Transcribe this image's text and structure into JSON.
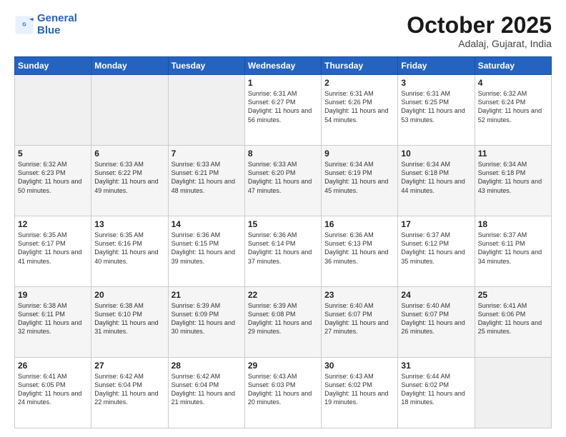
{
  "header": {
    "logo_general": "General",
    "logo_blue": "Blue",
    "month_title": "October 2025",
    "location": "Adalaj, Gujarat, India"
  },
  "weekdays": [
    "Sunday",
    "Monday",
    "Tuesday",
    "Wednesday",
    "Thursday",
    "Friday",
    "Saturday"
  ],
  "weeks": [
    [
      {
        "day": "",
        "sunrise": "",
        "sunset": "",
        "daylight": "",
        "empty": true
      },
      {
        "day": "",
        "sunrise": "",
        "sunset": "",
        "daylight": "",
        "empty": true
      },
      {
        "day": "",
        "sunrise": "",
        "sunset": "",
        "daylight": "",
        "empty": true
      },
      {
        "day": "1",
        "sunrise": "Sunrise: 6:31 AM",
        "sunset": "Sunset: 6:27 PM",
        "daylight": "Daylight: 11 hours and 56 minutes."
      },
      {
        "day": "2",
        "sunrise": "Sunrise: 6:31 AM",
        "sunset": "Sunset: 6:26 PM",
        "daylight": "Daylight: 11 hours and 54 minutes."
      },
      {
        "day": "3",
        "sunrise": "Sunrise: 6:31 AM",
        "sunset": "Sunset: 6:25 PM",
        "daylight": "Daylight: 11 hours and 53 minutes."
      },
      {
        "day": "4",
        "sunrise": "Sunrise: 6:32 AM",
        "sunset": "Sunset: 6:24 PM",
        "daylight": "Daylight: 11 hours and 52 minutes."
      }
    ],
    [
      {
        "day": "5",
        "sunrise": "Sunrise: 6:32 AM",
        "sunset": "Sunset: 6:23 PM",
        "daylight": "Daylight: 11 hours and 50 minutes."
      },
      {
        "day": "6",
        "sunrise": "Sunrise: 6:33 AM",
        "sunset": "Sunset: 6:22 PM",
        "daylight": "Daylight: 11 hours and 49 minutes."
      },
      {
        "day": "7",
        "sunrise": "Sunrise: 6:33 AM",
        "sunset": "Sunset: 6:21 PM",
        "daylight": "Daylight: 11 hours and 48 minutes."
      },
      {
        "day": "8",
        "sunrise": "Sunrise: 6:33 AM",
        "sunset": "Sunset: 6:20 PM",
        "daylight": "Daylight: 11 hours and 47 minutes."
      },
      {
        "day": "9",
        "sunrise": "Sunrise: 6:34 AM",
        "sunset": "Sunset: 6:19 PM",
        "daylight": "Daylight: 11 hours and 45 minutes."
      },
      {
        "day": "10",
        "sunrise": "Sunrise: 6:34 AM",
        "sunset": "Sunset: 6:18 PM",
        "daylight": "Daylight: 11 hours and 44 minutes."
      },
      {
        "day": "11",
        "sunrise": "Sunrise: 6:34 AM",
        "sunset": "Sunset: 6:18 PM",
        "daylight": "Daylight: 11 hours and 43 minutes."
      }
    ],
    [
      {
        "day": "12",
        "sunrise": "Sunrise: 6:35 AM",
        "sunset": "Sunset: 6:17 PM",
        "daylight": "Daylight: 11 hours and 41 minutes."
      },
      {
        "day": "13",
        "sunrise": "Sunrise: 6:35 AM",
        "sunset": "Sunset: 6:16 PM",
        "daylight": "Daylight: 11 hours and 40 minutes."
      },
      {
        "day": "14",
        "sunrise": "Sunrise: 6:36 AM",
        "sunset": "Sunset: 6:15 PM",
        "daylight": "Daylight: 11 hours and 39 minutes."
      },
      {
        "day": "15",
        "sunrise": "Sunrise: 6:36 AM",
        "sunset": "Sunset: 6:14 PM",
        "daylight": "Daylight: 11 hours and 37 minutes."
      },
      {
        "day": "16",
        "sunrise": "Sunrise: 6:36 AM",
        "sunset": "Sunset: 6:13 PM",
        "daylight": "Daylight: 11 hours and 36 minutes."
      },
      {
        "day": "17",
        "sunrise": "Sunrise: 6:37 AM",
        "sunset": "Sunset: 6:12 PM",
        "daylight": "Daylight: 11 hours and 35 minutes."
      },
      {
        "day": "18",
        "sunrise": "Sunrise: 6:37 AM",
        "sunset": "Sunset: 6:11 PM",
        "daylight": "Daylight: 11 hours and 34 minutes."
      }
    ],
    [
      {
        "day": "19",
        "sunrise": "Sunrise: 6:38 AM",
        "sunset": "Sunset: 6:11 PM",
        "daylight": "Daylight: 11 hours and 32 minutes."
      },
      {
        "day": "20",
        "sunrise": "Sunrise: 6:38 AM",
        "sunset": "Sunset: 6:10 PM",
        "daylight": "Daylight: 11 hours and 31 minutes."
      },
      {
        "day": "21",
        "sunrise": "Sunrise: 6:39 AM",
        "sunset": "Sunset: 6:09 PM",
        "daylight": "Daylight: 11 hours and 30 minutes."
      },
      {
        "day": "22",
        "sunrise": "Sunrise: 6:39 AM",
        "sunset": "Sunset: 6:08 PM",
        "daylight": "Daylight: 11 hours and 29 minutes."
      },
      {
        "day": "23",
        "sunrise": "Sunrise: 6:40 AM",
        "sunset": "Sunset: 6:07 PM",
        "daylight": "Daylight: 11 hours and 27 minutes."
      },
      {
        "day": "24",
        "sunrise": "Sunrise: 6:40 AM",
        "sunset": "Sunset: 6:07 PM",
        "daylight": "Daylight: 11 hours and 26 minutes."
      },
      {
        "day": "25",
        "sunrise": "Sunrise: 6:41 AM",
        "sunset": "Sunset: 6:06 PM",
        "daylight": "Daylight: 11 hours and 25 minutes."
      }
    ],
    [
      {
        "day": "26",
        "sunrise": "Sunrise: 6:41 AM",
        "sunset": "Sunset: 6:05 PM",
        "daylight": "Daylight: 11 hours and 24 minutes."
      },
      {
        "day": "27",
        "sunrise": "Sunrise: 6:42 AM",
        "sunset": "Sunset: 6:04 PM",
        "daylight": "Daylight: 11 hours and 22 minutes."
      },
      {
        "day": "28",
        "sunrise": "Sunrise: 6:42 AM",
        "sunset": "Sunset: 6:04 PM",
        "daylight": "Daylight: 11 hours and 21 minutes."
      },
      {
        "day": "29",
        "sunrise": "Sunrise: 6:43 AM",
        "sunset": "Sunset: 6:03 PM",
        "daylight": "Daylight: 11 hours and 20 minutes."
      },
      {
        "day": "30",
        "sunrise": "Sunrise: 6:43 AM",
        "sunset": "Sunset: 6:02 PM",
        "daylight": "Daylight: 11 hours and 19 minutes."
      },
      {
        "day": "31",
        "sunrise": "Sunrise: 6:44 AM",
        "sunset": "Sunset: 6:02 PM",
        "daylight": "Daylight: 11 hours and 18 minutes."
      },
      {
        "day": "",
        "sunrise": "",
        "sunset": "",
        "daylight": "",
        "empty": true
      }
    ]
  ]
}
